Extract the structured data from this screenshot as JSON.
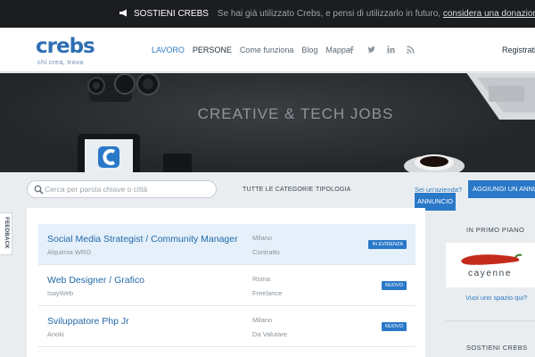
{
  "top_banner": {
    "label": "SOSTIENI CREBS",
    "message": "Se hai già utilizzato Crebs, e pensi di utilizzarlo in futuro,",
    "link": "considera una donazione"
  },
  "header": {
    "logo_word": "crebs",
    "logo_tagline": "chi crea, trova",
    "nav": [
      {
        "label": "LAVORO",
        "state": "active"
      },
      {
        "label": "PERSONE",
        "state": "dark"
      },
      {
        "label": "Come funziona",
        "state": "normal"
      },
      {
        "label": "Blog",
        "state": "normal"
      },
      {
        "label": "Mappa",
        "state": "normal"
      }
    ],
    "social_icons": [
      "facebook-icon",
      "twitter-icon",
      "linkedin-icon",
      "rss-icon"
    ],
    "register": "Registrati"
  },
  "hero": {
    "title": "CREATIVE & TECH JOBS"
  },
  "search": {
    "placeholder": "Cerca per parola chiave o città",
    "categories": "TUTTE LE CATEGORIE",
    "type": "TIPOLOGIA",
    "company_prompt": "Sei un'azienda?",
    "add_button": "AGGIUNGI UN ANNUNCIO"
  },
  "jobs": [
    {
      "title": "Social Media Strategist / Community Manager",
      "company": "Alquimia WRG",
      "city": "Milano",
      "type": "Contratto",
      "badge": "IN EVIDENZA",
      "featured": true
    },
    {
      "title": "Web Designer / Grafico",
      "company": "IsayWeb",
      "city": "Roma",
      "type": "Freelance",
      "badge": "NUOVO",
      "featured": false
    },
    {
      "title": "Sviluppatore Php Jr",
      "company": "Anoki",
      "city": "Milano",
      "type": "Da Valutare",
      "badge": "NUOVO",
      "featured": false
    }
  ],
  "sidebar": {
    "featured_heading": "IN PRIMO PIANO",
    "sponsor_name": "cayenne",
    "sponsor_link": "Vuoi uno spazio qui?",
    "support_heading": "SOSTIENI CREBS"
  },
  "feedback": "FEEDBACK",
  "colors": {
    "accent": "#2a78c8",
    "topbar": "#1b1d20",
    "hero": "#2b2e31",
    "featured_row": "#e5f0fa"
  }
}
